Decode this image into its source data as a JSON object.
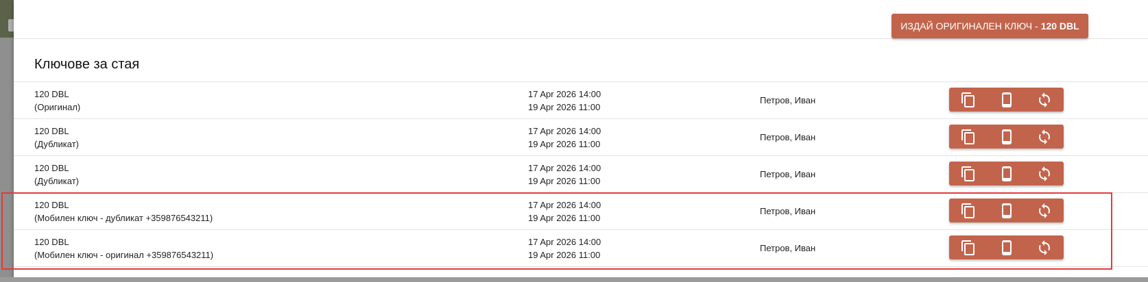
{
  "dialog": {
    "issue_button": {
      "label": "ИЗДАЙ ОРИГИНАЛЕН КЛЮЧ -",
      "price": "120 DBL"
    },
    "section_title": "Ключове за стая"
  },
  "keys": [
    {
      "price": "120 DBL",
      "type": "(Оригинал)",
      "checkin": "17 Apr 2026 14:00",
      "checkout": "19 Apr 2026 11:00",
      "holder": "Петров, Иван"
    },
    {
      "price": "120 DBL",
      "type": "(Дубликат)",
      "checkin": "17 Apr 2026 14:00",
      "checkout": "19 Apr 2026 11:00",
      "holder": "Петров, Иван"
    },
    {
      "price": "120 DBL",
      "type": "(Дубликат)",
      "checkin": "17 Apr 2026 14:00",
      "checkout": "19 Apr 2026 11:00",
      "holder": "Петров, Иван"
    },
    {
      "price": "120 DBL",
      "type": "(Мобилен ключ - дубликат +359876543211)",
      "checkin": "17 Apr 2026 14:00",
      "checkout": "19 Apr 2026 11:00",
      "holder": "Петров, Иван"
    },
    {
      "price": "120 DBL",
      "type": "(Мобилен ключ - оригинал +359876543211)",
      "checkin": "17 Apr 2026 14:00",
      "checkout": "19 Apr 2026 11:00",
      "holder": "Петров, Иван"
    }
  ],
  "row_actions": [
    "copy-icon",
    "mobile-phone-icon",
    "sync-icon"
  ],
  "colors": {
    "accent": "#c2644c",
    "highlight_border": "#e23b3b",
    "backdrop": "#8f8f8f"
  }
}
